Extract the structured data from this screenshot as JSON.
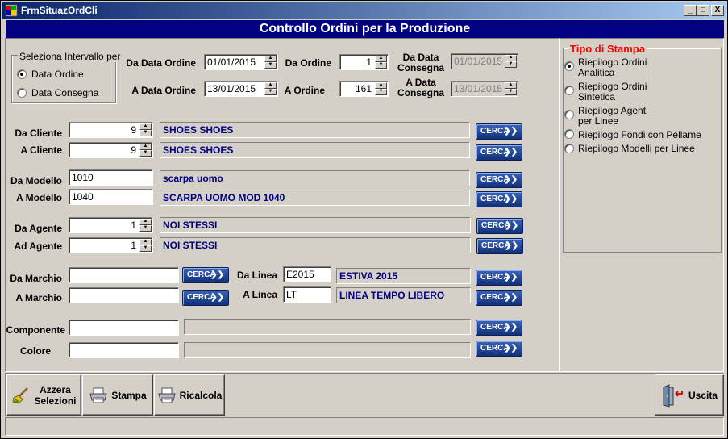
{
  "window": {
    "title": "FrmSituazOrdCli",
    "minimize": "_",
    "maximize": "□",
    "close": "X"
  },
  "header": {
    "title": "Controllo Ordini per la Produzione"
  },
  "interval": {
    "group_title": "Seleziona Intervallo per",
    "options": [
      {
        "label": "Data Ordine",
        "selected": true
      },
      {
        "label": "Data Consegna",
        "selected": false
      }
    ]
  },
  "dates": {
    "da_data_ordine": {
      "label": "Da Data Ordine",
      "value": "01/01/2015"
    },
    "a_data_ordine": {
      "label": "A Data Ordine",
      "value": "13/01/2015"
    },
    "da_ordine": {
      "label": "Da Ordine",
      "value": "1"
    },
    "a_ordine": {
      "label": "A Ordine",
      "value": "161"
    },
    "da_data_consegna": {
      "label_line1": "Da Data",
      "label_line2": "Consegna",
      "value": "01/01/2015"
    },
    "a_data_consegna": {
      "label_line1": "A Data",
      "label_line2": "Consegna",
      "value": "13/01/2015"
    }
  },
  "filters": {
    "da_cliente": {
      "label": "Da Cliente",
      "value": "9",
      "desc": "SHOES  SHOES"
    },
    "a_cliente": {
      "label": "A Cliente",
      "value": "9",
      "desc": "SHOES  SHOES"
    },
    "da_modello": {
      "label": "Da Modello",
      "value": "1010",
      "desc": "scarpa uomo"
    },
    "a_modello": {
      "label": "A Modello",
      "value": "1040",
      "desc": "SCARPA UOMO MOD 1040"
    },
    "da_agente": {
      "label": "Da Agente",
      "value": "1",
      "desc": "NOI STESSI"
    },
    "ad_agente": {
      "label": "Ad Agente",
      "value": "1",
      "desc": "NOI STESSI"
    },
    "da_marchio": {
      "label": "Da Marchio",
      "value": ""
    },
    "a_marchio": {
      "label": "A Marchio",
      "value": ""
    },
    "da_linea": {
      "label": "Da Linea",
      "value": "E2015",
      "desc": "ESTIVA 2015"
    },
    "a_linea": {
      "label": "A Linea",
      "value": "LT",
      "desc": "LINEA TEMPO LIBERO"
    },
    "componente": {
      "label": "Componente",
      "value": "",
      "desc": ""
    },
    "colore": {
      "label": "Colore",
      "value": "",
      "desc": ""
    }
  },
  "cerca_label": "CERCA",
  "stampa": {
    "group_title": "Tipo di Stampa",
    "title_color": "#ff0000",
    "options": [
      {
        "line1": "Riepilogo Ordini",
        "line2": "Analitica",
        "selected": true
      },
      {
        "line1": "Riepilogo Ordini",
        "line2": "Sintetica",
        "selected": false
      },
      {
        "line1": "Riepilogo Agenti",
        "line2": "per Linee",
        "selected": false
      },
      {
        "line1": "Riepilogo Fondi con Pellame",
        "line2": "",
        "selected": false
      },
      {
        "line1": "Riepilogo Modelli per Linee",
        "line2": "",
        "selected": false
      }
    ]
  },
  "toolbar": {
    "azzera_line1": "Azzera",
    "azzera_line2": "Selezioni",
    "stampa": "Stampa",
    "ricalcola": "Ricalcola",
    "uscita": "Uscita"
  },
  "colors": {
    "header_bg": "#000080",
    "desc_text": "#000080",
    "cerca_bg": "#1c3f91"
  },
  "icons": [
    "app-icon",
    "broom-icon",
    "printer-icon",
    "exit-door-icon",
    "chevron-right-icon"
  ]
}
